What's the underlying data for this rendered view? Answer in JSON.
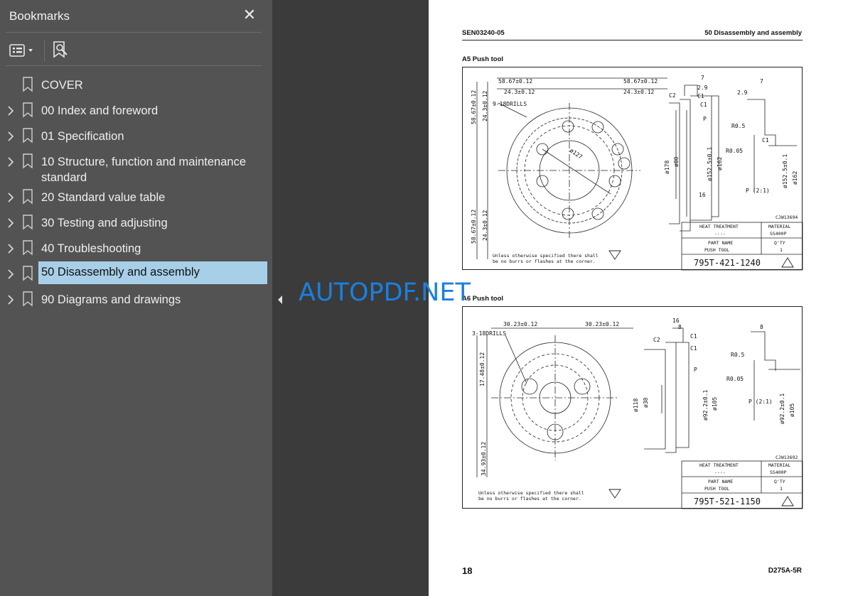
{
  "sidebar": {
    "title": "Bookmarks",
    "close_icon": "close-icon",
    "options_icon": "bookmark-options-icon",
    "find_icon": "find-current-bookmark-icon",
    "items": [
      {
        "label": "COVER",
        "expandable": false,
        "selected": false
      },
      {
        "label": "00 Index and foreword",
        "expandable": true,
        "selected": false
      },
      {
        "label": "01 Specification",
        "expandable": true,
        "selected": false
      },
      {
        "label": "10 Structure, function and maintenance standard",
        "expandable": true,
        "selected": false
      },
      {
        "label": "20 Standard value table",
        "expandable": true,
        "selected": false
      },
      {
        "label": "30 Testing and adjusting",
        "expandable": true,
        "selected": false
      },
      {
        "label": "40 Troubleshooting",
        "expandable": true,
        "selected": false
      },
      {
        "label": "50 Disassembly and assembly",
        "expandable": true,
        "selected": true
      },
      {
        "label": "90 Diagrams and drawings",
        "expandable": true,
        "selected": false
      }
    ]
  },
  "page": {
    "doc_code": "SEN03240-05",
    "section": "50 Disassembly and assembly",
    "page_number": "18",
    "model": "D275A-5R",
    "drawings": [
      {
        "caption": "A5 Push tool",
        "dims": {
          "d1": "58.67±0.12",
          "d2": "24.3±0.12",
          "d3": "58.67±0.12",
          "d4": "24.3±0.12",
          "drills": "9-18DRILLS",
          "pcd": "ø127",
          "v1": "58.67±0.12",
          "v2": "24.3±0.12",
          "v3": "58.67±0.12",
          "v4": "24.3±0.12",
          "od": "ø178",
          "id": "ø80",
          "dia2": "ø152.5±0.1",
          "dia3": "ø162",
          "top7": "7",
          "t29": "2.9",
          "c2": "C2",
          "c1a": "C1",
          "c1b": "C1",
          "p": "P",
          "w16": "16",
          "r05a": "R0.5",
          "r05b": "R0.05",
          "det7": "7",
          "det29": "2.9",
          "detc1": "C1",
          "detdia": "ø152.5±0.1",
          "detdia2": "ø162",
          "scale": "P (2:1)",
          "cjw": "CJW13694"
        },
        "title_block": {
          "heat_h": "HEAT TREATMENT",
          "heat_v": "----",
          "mat_h": "MATERIAL",
          "mat_v": "SS400P",
          "part_h": "PART NAME",
          "part_v": "PUSH TOOL",
          "qty_h": "Q'TY",
          "qty_v": "1",
          "part_no": "795T-421-1240"
        },
        "note1": "Unless otherwise specified there shall",
        "note2": "be no burrs or flashes at the corner."
      },
      {
        "caption": "A6 Push tool",
        "dims": {
          "d1": "30.23±0.12",
          "d2": "30.23±0.12",
          "drills": "3-18DRILLS",
          "v1": "17.48±0.12",
          "v2": "34.93±0.12",
          "od": "ø118",
          "id": "ø38",
          "dia2": "ø92.2±0.1",
          "dia3": "ø105",
          "top16": "16",
          "top8": "8",
          "c2": "C2",
          "c1a": "C1",
          "c1b": "C1",
          "p": "P",
          "r05a": "R0.5",
          "r05b": "R0.05",
          "det8": "8",
          "detdia": "ø92.2±0.1",
          "detdia2": "ø105",
          "scale": "P (2:1)",
          "cjw": "CJW13692"
        },
        "title_block": {
          "heat_h": "HEAT TREATMENT",
          "heat_v": "----",
          "mat_h": "MATERIAL",
          "mat_v": "SS400P",
          "part_h": "PART NAME",
          "part_v": "PUSH TOOL",
          "qty_h": "Q'TY",
          "qty_v": "1",
          "part_no": "795T-521-1150"
        },
        "note1": "Unless otherwise specified there shall",
        "note2": "be no burrs or flashes at the corner."
      }
    ]
  },
  "watermark": "AUTOPDF.NET",
  "colors": {
    "sidebar_bg": "#535353",
    "viewer_bg": "#3b3b3b",
    "selection": "#a8cfe8",
    "watermark": "#1b7fe0"
  }
}
